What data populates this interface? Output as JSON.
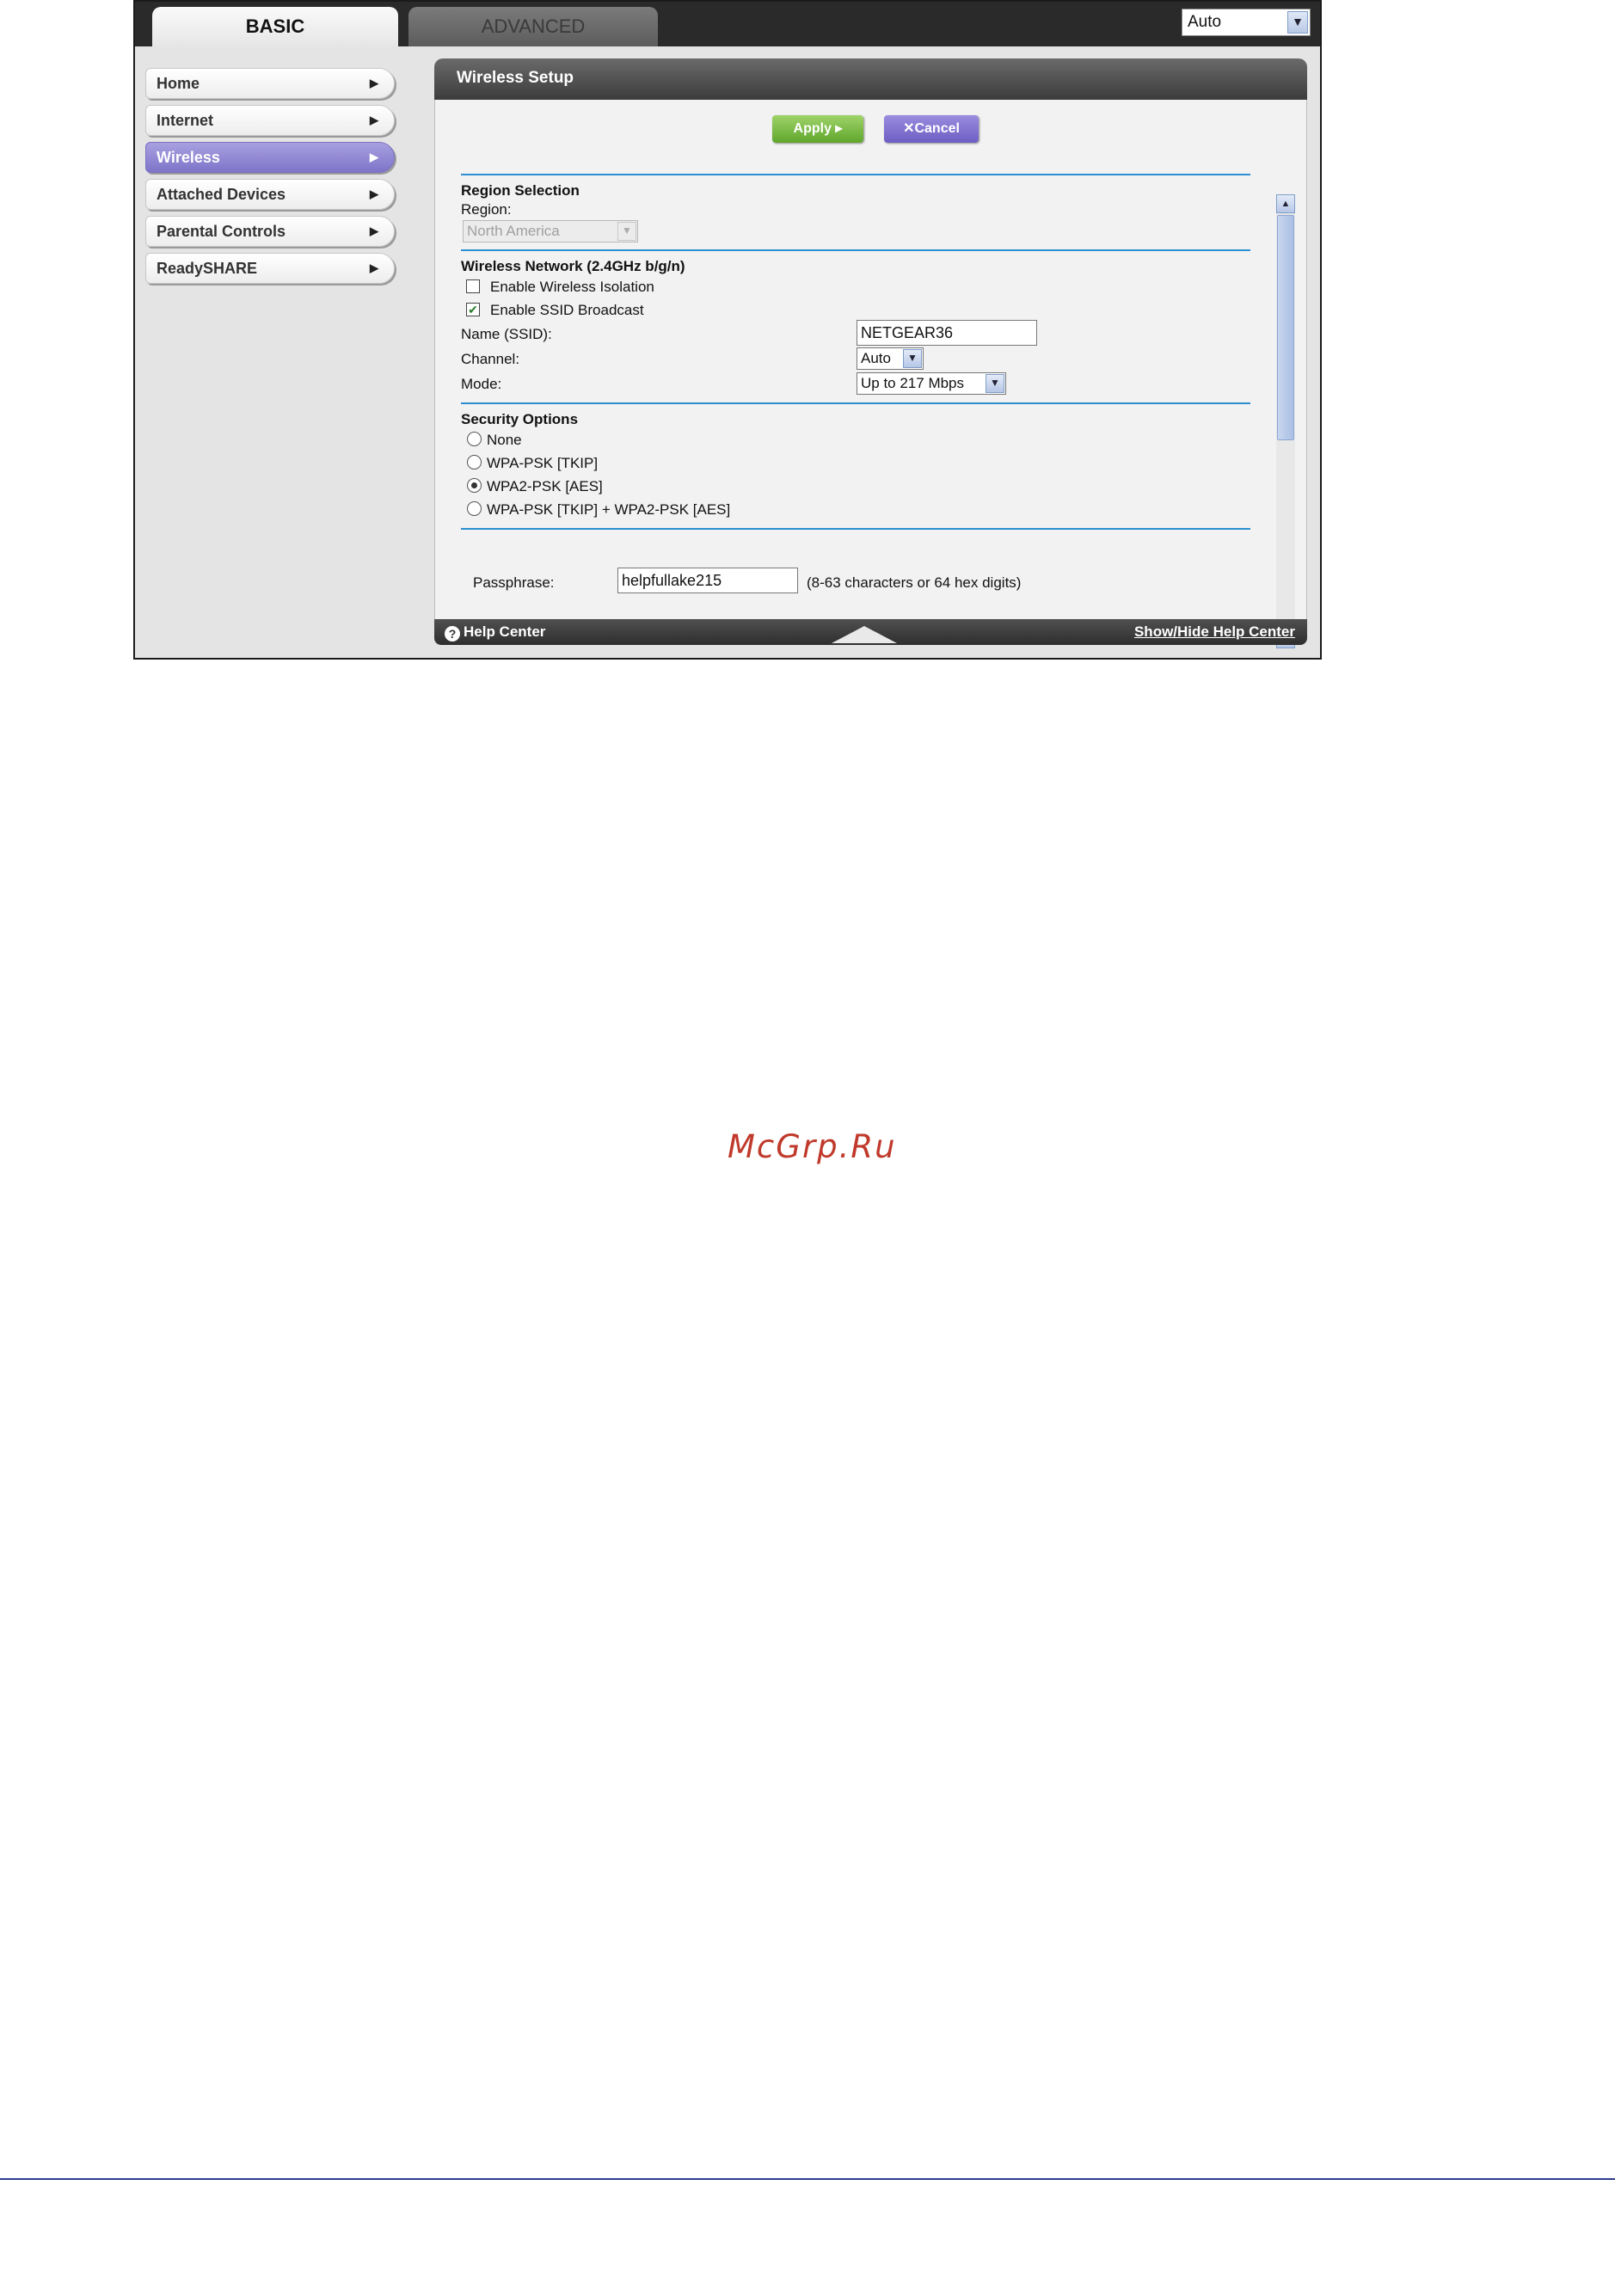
{
  "tabs": {
    "basic": "BASIC",
    "advanced": "ADVANCED"
  },
  "language_select": {
    "value": "Auto"
  },
  "sidebar": {
    "items": [
      {
        "label": "Home"
      },
      {
        "label": "Internet"
      },
      {
        "label": "Wireless",
        "active": true
      },
      {
        "label": "Attached Devices"
      },
      {
        "label": "Parental Controls"
      },
      {
        "label": "ReadySHARE"
      }
    ]
  },
  "panel": {
    "title": "Wireless Setup",
    "apply_label": "Apply ▸",
    "cancel_label": "✕Cancel"
  },
  "region": {
    "heading": "Region Selection",
    "label": "Region:",
    "value": "North America"
  },
  "wireless": {
    "heading": "Wireless Network (2.4GHz b/g/n)",
    "isolation_label": "Enable Wireless Isolation",
    "isolation_checked": false,
    "ssid_broadcast_label": "Enable SSID Broadcast",
    "ssid_broadcast_checked": true,
    "ssid_label": "Name (SSID):",
    "ssid_value": "NETGEAR36",
    "channel_label": "Channel:",
    "channel_value": "Auto",
    "mode_label": "Mode:",
    "mode_value": "Up to 217 Mbps"
  },
  "security": {
    "heading": "Security Options",
    "options": [
      {
        "label": "None",
        "selected": false
      },
      {
        "label": "WPA-PSK [TKIP]",
        "selected": false
      },
      {
        "label": "WPA2-PSK [AES]",
        "selected": true
      },
      {
        "label": "WPA-PSK [TKIP] + WPA2-PSK [AES]",
        "selected": false
      }
    ],
    "passphrase_label": "Passphrase:",
    "passphrase_value": "helpfullake215",
    "passphrase_hint": "(8-63 characters or 64 hex digits)"
  },
  "footer": {
    "help_center": "Help Center",
    "show_hide": "Show/Hide Help Center"
  },
  "watermark": "McGrp.Ru",
  "colors": {
    "accent_blue": "#2b8fd1",
    "active_purple": "#7e74c9",
    "apply_green": "#5fa62c",
    "watermark_red": "#c0392b"
  }
}
